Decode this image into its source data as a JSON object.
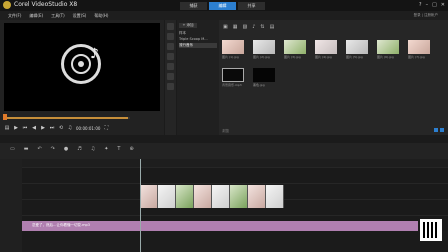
{
  "app": {
    "title": "Corel VideoStudio X8",
    "tabs": [
      "捕获",
      "编辑",
      "共享"
    ],
    "active_tab": 1
  },
  "menu": [
    "文件(F)",
    "编辑(E)",
    "工具(T)",
    "设置(S)",
    "帮助(H)"
  ],
  "user": "登录 | 注册帐户",
  "preview": {
    "timecode": "00:00:01:00"
  },
  "library": {
    "add_label": "+ 添加",
    "folders": [
      "样本",
      "Triple Scoop M...",
      "流行音乐"
    ],
    "selected_folder": 2,
    "thumbs": [
      {
        "kind": "photo1",
        "label": "图片 (1).jpg"
      },
      {
        "kind": "photo2",
        "label": "图片 (2).jpg"
      },
      {
        "kind": "photo3",
        "label": "图片 (3).jpg"
      },
      {
        "kind": "photo4",
        "label": "图片 (4).jpg"
      },
      {
        "kind": "photo2",
        "label": "图片 (5).jpg"
      },
      {
        "kind": "photo3",
        "label": "图片 (6).jpg"
      },
      {
        "kind": "photo1",
        "label": "图片 (7).jpg"
      },
      {
        "kind": "audio",
        "label": "背景音乐.mp3"
      },
      {
        "kind": "black",
        "label": "黑色.jpg"
      }
    ],
    "status": "浏览"
  },
  "timeline": {
    "audio_clip": "恋爱了，然后…让你看懂一切变.mp3",
    "clip_count": 8
  }
}
